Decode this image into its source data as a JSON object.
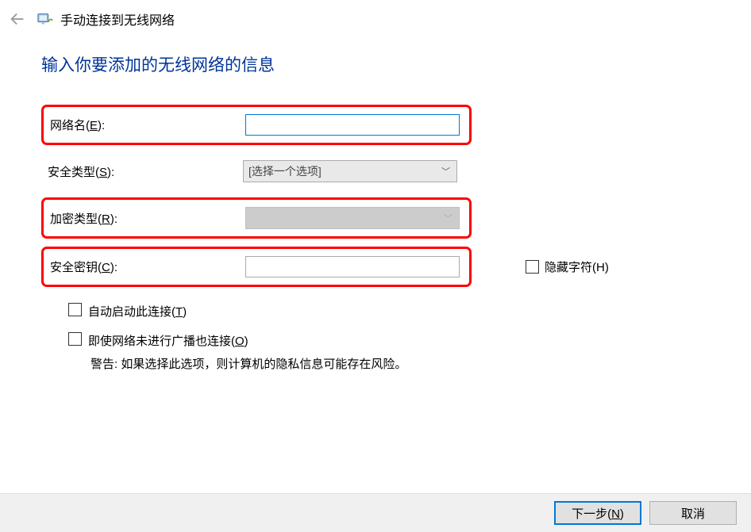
{
  "header": {
    "window_title": "手动连接到无线网络"
  },
  "heading": "输入你要添加的无线网络的信息",
  "form": {
    "network_name": {
      "label_pre": "网络名(",
      "hotkey": "E",
      "label_post": "):",
      "value": ""
    },
    "security_type": {
      "label_pre": "安全类型(",
      "hotkey": "S",
      "label_post": "):",
      "selected": "[选择一个选项]"
    },
    "encryption_type": {
      "label_pre": "加密类型(",
      "hotkey": "R",
      "label_post": "):",
      "selected": ""
    },
    "security_key": {
      "label_pre": "安全密钥(",
      "hotkey": "C",
      "label_post": "):",
      "value": ""
    },
    "hide_chars": {
      "label_pre": "隐藏字符(",
      "hotkey": "H",
      "label_post": ")"
    }
  },
  "options": {
    "auto_start": {
      "label_pre": "自动启动此连接(",
      "hotkey": "T",
      "label_post": ")"
    },
    "connect_hidden": {
      "label_pre": "即使网络未进行广播也连接(",
      "hotkey": "O",
      "label_post": ")"
    },
    "warning": "警告: 如果选择此选项，则计算机的隐私信息可能存在风险。"
  },
  "footer": {
    "next": {
      "label_pre": "下一步(",
      "hotkey": "N",
      "label_post": ")"
    },
    "cancel": "取消"
  }
}
